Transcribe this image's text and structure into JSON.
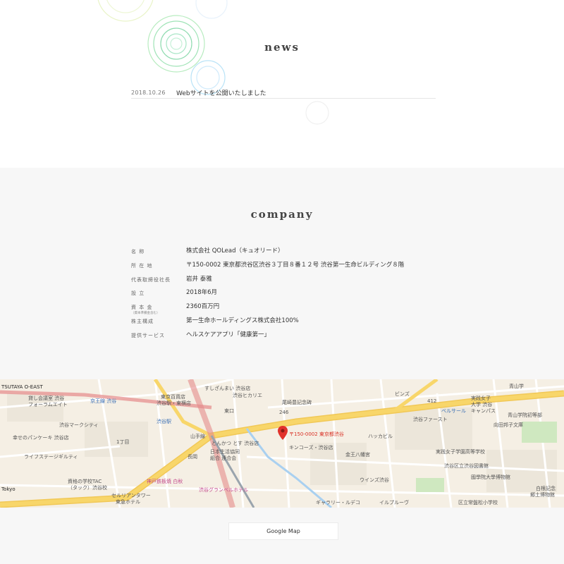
{
  "news": {
    "heading": "news",
    "items": [
      {
        "date": "2018.10.26",
        "text": "Webサイトを公開いたしました"
      }
    ]
  },
  "company": {
    "heading": "company",
    "rows": [
      {
        "label": "名 称",
        "value": "株式会社 QOLead（キュオリード）"
      },
      {
        "label": "所 在 地",
        "value": "〒150-0002 東京都渋谷区渋谷３丁目８番１２号 渋谷第一生命ビルディング８階"
      },
      {
        "label": "代表取締役社長",
        "value": "岩井 泰雅"
      },
      {
        "label": "設 立",
        "value": "2018年6月"
      },
      {
        "label": "資 本 金",
        "sublabel": "（資本準備金含む）",
        "value": "2360百万円"
      },
      {
        "label": "株主構成",
        "value": "第一生命ホールディングス株式会社100%"
      },
      {
        "label": "提供サービス",
        "value": "ヘルスケアアプリ「健康第一」"
      }
    ]
  },
  "map": {
    "pin_label": "〒150-0002 東京都渋谷",
    "labels": {
      "tsutaya": "TSUTAYA O-EAST",
      "kashikaigi": "貸し会議室 渋谷",
      "forum": "フォーラムエイト",
      "keio": "京王線 渋谷",
      "tokyu_dept": "東京百貨店",
      "tokyu_dept2": "渋谷駅・東横店",
      "sushi": "すしざんまい 渋谷店",
      "hikarie": "渋谷ヒカリエ",
      "osaki": "尾崎豊記念碑",
      "higashiguchi": "東口",
      "bienz": "ビンズ",
      "aoyama": "青山学",
      "jissen": "実践女子",
      "jissen2": "大学 渋谷",
      "jissen3": "キャンパス",
      "shibuya_mark": "渋谷マークシティ",
      "shibuya_stn": "渋谷駅",
      "shibuya_first": "渋谷ファースト",
      "bellsalle": "ベルサール",
      "aoyama_school": "青山学院初等部",
      "mukouda": "向田邦子文庫",
      "pancake": "幸せのパンケーキ 渋谷店",
      "chome1": "1丁目",
      "kinkos": "キンコーズ・渋谷店",
      "konpira": "金王八幡宮",
      "jissen_school": "実践女子学園高等学校",
      "library": "渋谷区立渋谷図書館",
      "live": "ライフステージギルティ",
      "nagaoka": "長岡",
      "nihon": "日本生活協同",
      "nihon2": "組合 連合会",
      "tonkatsu": "とんかつ とす 渋谷店",
      "winds": "ウインズ渋谷",
      "kokugakuin": "國學院大學博物館",
      "tokyo": "Tokyo",
      "shikaku": "資格の学校TAC",
      "shikaku2": "（タック）渋谷校",
      "kobe": "神戸鉄板焼 白秋",
      "granbell": "渋谷グランベルホテル",
      "cerulean": "セルリアンタワー",
      "cerulean2": "東急ホテル",
      "gallery": "ギャラリー・ルデコ",
      "ilpleut": "イルプルーヴ",
      "hakkafe": "ハッカビル",
      "kinenkan": "白根記念",
      "kyodo": "郷土博物館",
      "nishihara": "区立常盤松小学校",
      "route246": "246",
      "route412": "412",
      "yamanote": "山手線"
    }
  },
  "google_map_button": "Google Map",
  "colors": {
    "page_bg": "#ffffff",
    "section_bg": "#f7f7f7",
    "map_bg": "#f5efe4",
    "road_yellow": "#f8d66a",
    "rail_red": "#e58a8a",
    "pin_red": "#e1322c"
  }
}
